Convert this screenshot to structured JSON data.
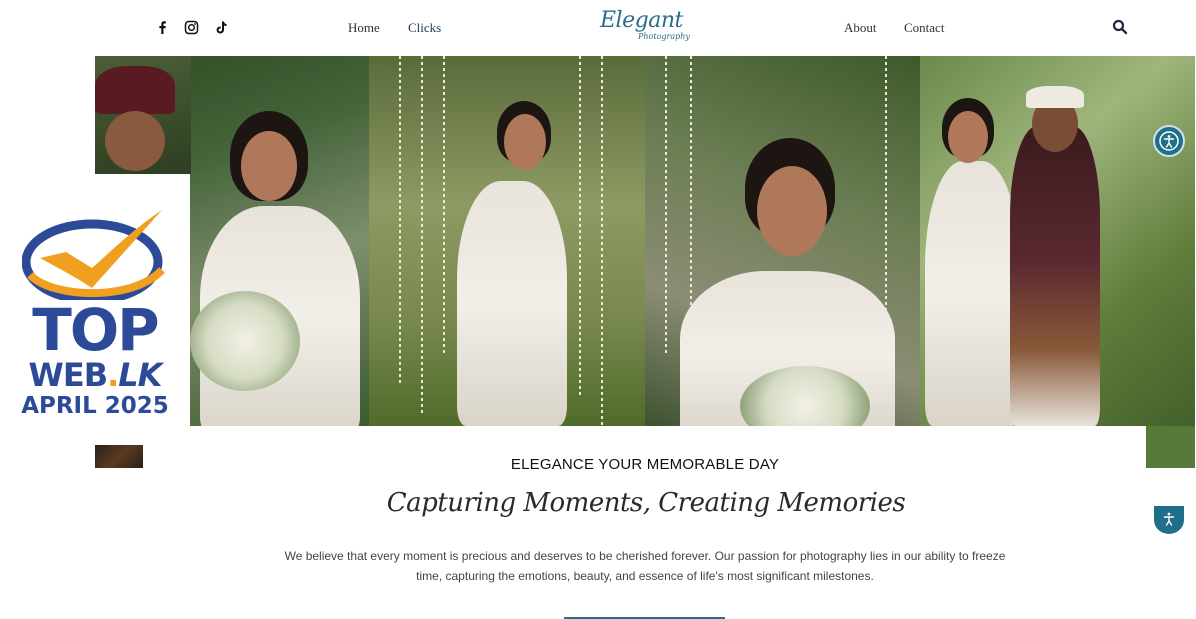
{
  "header": {
    "social": [
      {
        "icon": "facebook-icon",
        "glyph": "f"
      },
      {
        "icon": "instagram-icon",
        "glyph": ""
      },
      {
        "icon": "tiktok-icon",
        "glyph": "♪"
      }
    ],
    "nav_left": [
      "Home",
      "Clicks"
    ],
    "nav_right": [
      "About",
      "Contact"
    ],
    "logo_main": "Elegant",
    "logo_sub": "Photography",
    "search_icon": "search-icon"
  },
  "badge": {
    "line1": "TOP",
    "line2_a": "WEB",
    "line2_dot": ".",
    "line2_b": "LK",
    "line3": "APRIL 2025"
  },
  "hero": {
    "tagline": "ELEGANCE YOUR MEMORABLE DAY",
    "script_title": "Capturing Moments, Creating Memories",
    "paragraph": "We believe that every moment is precious and deserves to be cherished forever. Our passion for photography lies in our ability to freeze time, capturing the emotions, beauty, and essence of life's most significant milestones."
  },
  "colors": {
    "accent": "#2a6d8a",
    "badge_blue": "#2d4a99",
    "badge_orange": "#f0a020"
  }
}
